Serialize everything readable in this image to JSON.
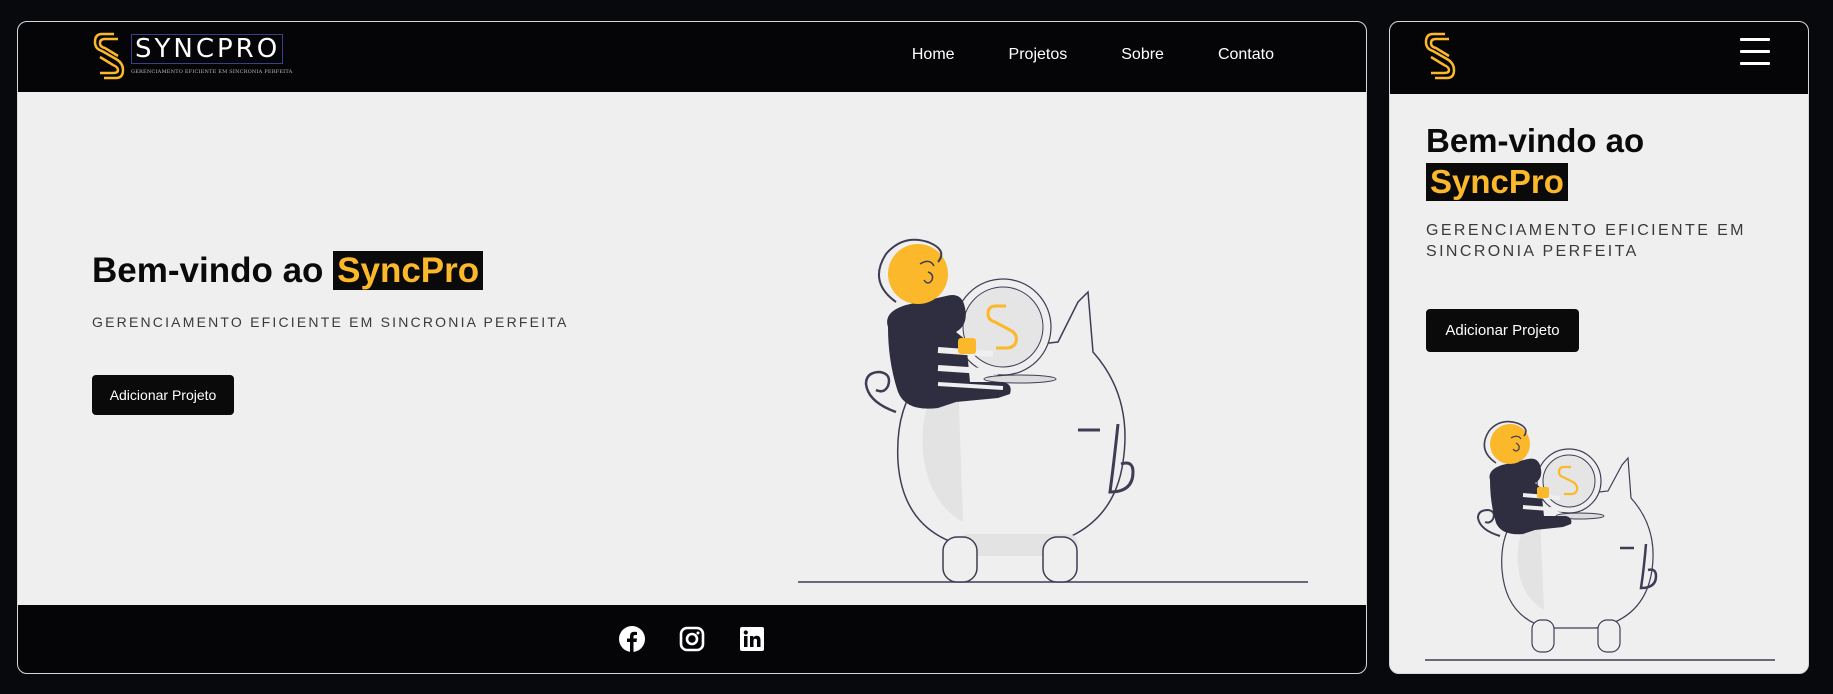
{
  "brand": {
    "name": "SYNCPRO",
    "tagline": "GERENCIAMENTO EFICIENTE EM SINCRONIA PERFEITA",
    "accent": "#fbb82a",
    "dark": "#0a0a0a"
  },
  "nav": {
    "items": [
      "Home",
      "Projetos",
      "Sobre",
      "Contato"
    ]
  },
  "hero": {
    "title_prefix": "Bem-vindo ao",
    "title_highlight": "SyncPro",
    "subtitle": "GERENCIAMENTO EFICIENTE EM SINCRONIA PERFEITA",
    "cta_label": "Adicionar Projeto"
  },
  "footer": {
    "social": [
      "facebook-icon",
      "instagram-icon",
      "linkedin-icon"
    ]
  },
  "mobile": {
    "menu_icon": "hamburger-menu-icon"
  }
}
